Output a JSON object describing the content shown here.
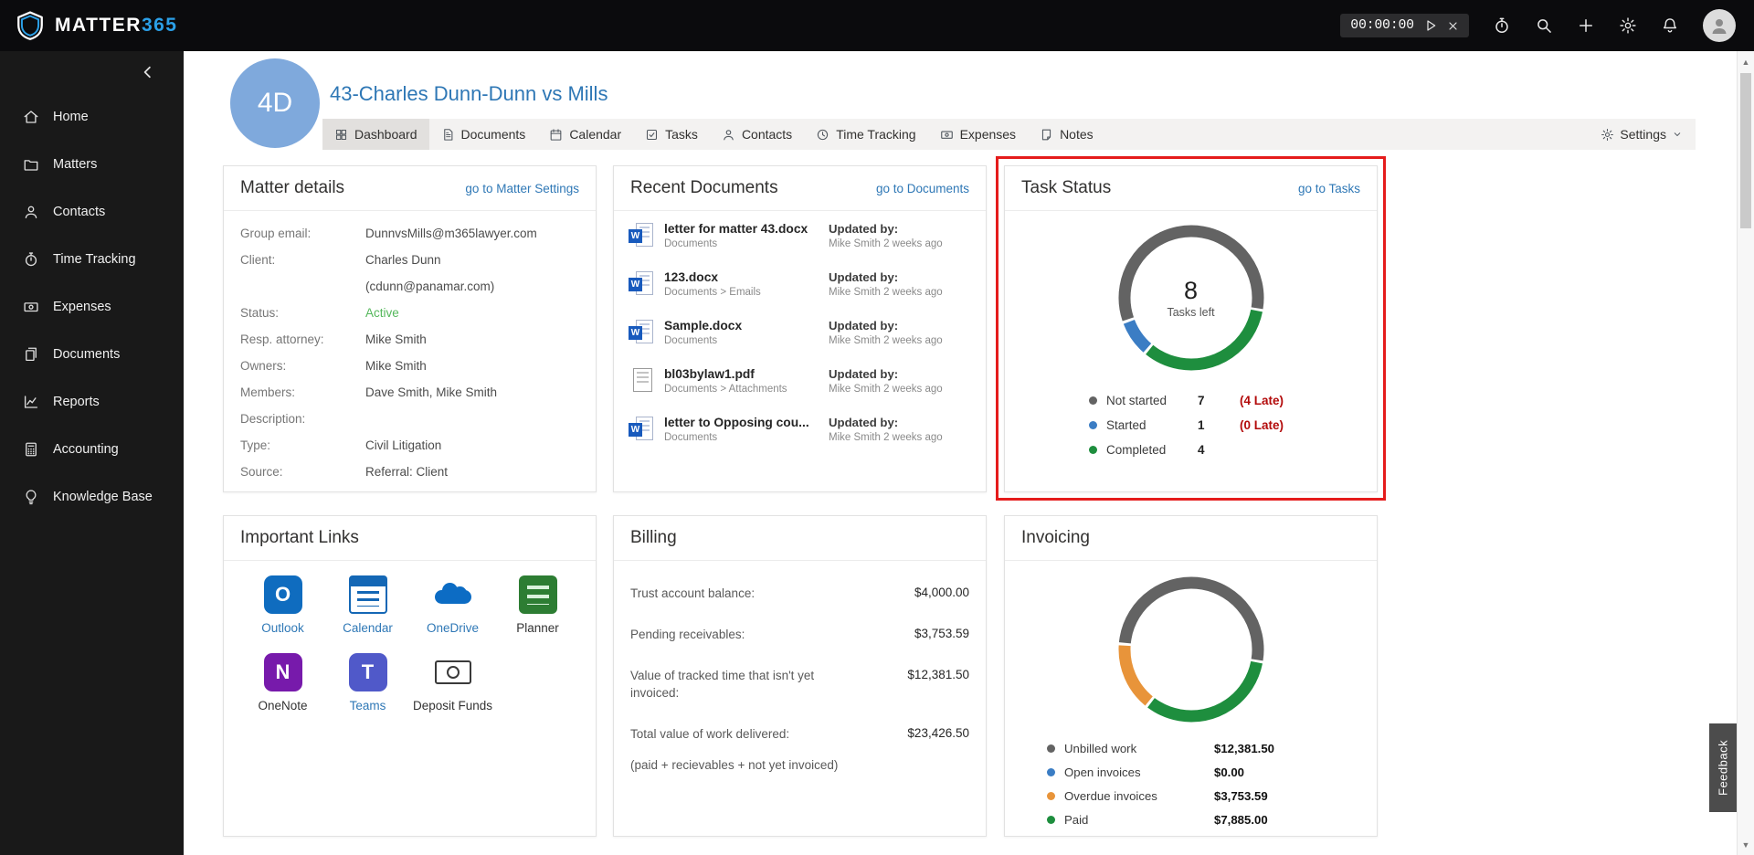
{
  "topbar": {
    "brand_primary": "MATTER",
    "brand_secondary": "365",
    "timer_value": "00:00:00"
  },
  "sidebar": {
    "items": [
      {
        "label": "Home",
        "icon": "#i-home"
      },
      {
        "label": "Matters",
        "icon": "#i-folder"
      },
      {
        "label": "Contacts",
        "icon": "#i-person"
      },
      {
        "label": "Time Tracking",
        "icon": "#i-stopwatch"
      },
      {
        "label": "Expenses",
        "icon": "#i-money"
      },
      {
        "label": "Documents",
        "icon": "#i-docs"
      },
      {
        "label": "Reports",
        "icon": "#i-chart"
      },
      {
        "label": "Accounting",
        "icon": "#i-calc"
      },
      {
        "label": "Knowledge Base",
        "icon": "#i-bulb"
      }
    ]
  },
  "matter": {
    "avatar_initials": "4D",
    "title": "43-Charles Dunn-Dunn vs Mills"
  },
  "tabs": [
    {
      "label": "Dashboard",
      "icon": "#i-grid",
      "active": "active"
    },
    {
      "label": "Documents",
      "icon": "#i-doc"
    },
    {
      "label": "Calendar",
      "icon": "#i-calendar"
    },
    {
      "label": "Tasks",
      "icon": "#i-tasks"
    },
    {
      "label": "Contacts",
      "icon": "#i-person"
    },
    {
      "label": "Time Tracking",
      "icon": "#i-clock"
    },
    {
      "label": "Expenses",
      "icon": "#i-money"
    },
    {
      "label": "Notes",
      "icon": "#i-note"
    }
  ],
  "settings_label": "Settings",
  "matter_details": {
    "title": "Matter details",
    "link": "go to Matter Settings",
    "rows": [
      {
        "label": "Group email:",
        "value": "DunnvsMills@m365lawyer.com"
      },
      {
        "label": "Client:",
        "value": "Charles Dunn"
      },
      {
        "label": "",
        "value": "(cdunn@panamar.com)"
      },
      {
        "label": "Status:",
        "value": "Active",
        "value_class": "green"
      },
      {
        "label": "Resp. attorney:",
        "value": "Mike Smith"
      },
      {
        "label": "Owners:",
        "value": "Mike Smith"
      },
      {
        "label": "Members:",
        "value": "Dave Smith, Mike Smith"
      },
      {
        "label": "Description:",
        "value": ""
      },
      {
        "label": "Type:",
        "value": "Civil Litigation"
      },
      {
        "label": "Source:",
        "value": "Referral: Client"
      }
    ]
  },
  "recent_documents": {
    "title": "Recent Documents",
    "link": "go to Documents",
    "items": [
      {
        "name": "letter for matter 43.docx",
        "path": "Documents",
        "doctype": "word",
        "updated_label": "Updated by:",
        "updated_meta": "Mike Smith 2 weeks ago"
      },
      {
        "name": "123.docx",
        "path": "Documents > Emails",
        "doctype": "word",
        "updated_label": "Updated by:",
        "updated_meta": "Mike Smith 2 weeks ago"
      },
      {
        "name": "Sample.docx",
        "path": "Documents",
        "doctype": "word",
        "updated_label": "Updated by:",
        "updated_meta": "Mike Smith 2 weeks ago"
      },
      {
        "name": "bl03bylaw1.pdf",
        "path": "Documents > Attachments",
        "doctype": "pdf",
        "updated_label": "Updated by:",
        "updated_meta": "Mike Smith 2 weeks ago"
      },
      {
        "name": "letter to Opposing cou...",
        "path": "Documents",
        "doctype": "word",
        "updated_label": "Updated by:",
        "updated_meta": "Mike Smith 2 weeks ago"
      }
    ]
  },
  "task_status": {
    "title": "Task Status",
    "link": "go to Tasks",
    "center_value": "8",
    "center_label": "Tasks left",
    "legend": [
      {
        "name": "Not started",
        "count": "7",
        "late": "(4 Late)",
        "color": "#636363"
      },
      {
        "name": "Started",
        "count": "1",
        "late": "(0 Late)",
        "color": "#3b7dc4"
      },
      {
        "name": "Completed",
        "count": "4",
        "late": "",
        "color": "#1e8e3e"
      }
    ]
  },
  "important_links": {
    "title": "Important Links",
    "items": [
      {
        "label": "Outlook",
        "icon": "outlook",
        "style": "blue"
      },
      {
        "label": "Calendar",
        "icon": "calendar",
        "style": "blue"
      },
      {
        "label": "OneDrive",
        "icon": "onedrive",
        "style": "blue"
      },
      {
        "label": "Planner",
        "icon": "planner",
        "style": "dark"
      },
      {
        "label": "OneNote",
        "icon": "onenote",
        "style": "dark"
      },
      {
        "label": "Teams",
        "icon": "teams",
        "style": "blue"
      },
      {
        "label": "Deposit Funds",
        "icon": "deposit",
        "style": "dark"
      }
    ]
  },
  "billing": {
    "title": "Billing",
    "rows": [
      {
        "label": "Trust account balance:",
        "value": "$4,000.00"
      },
      {
        "label": "Pending receivables:",
        "value": "$3,753.59"
      },
      {
        "label": "Value of tracked time that isn't yet invoiced:",
        "value": "$12,381.50"
      },
      {
        "label": "Total value of work delivered:",
        "value": "$23,426.50"
      },
      {
        "label": "(paid + recievables + not yet invoiced)",
        "value": ""
      }
    ]
  },
  "invoicing": {
    "title": "Invoicing",
    "legend": [
      {
        "name": "Unbilled work",
        "amount": "$12,381.50",
        "color": "#636363"
      },
      {
        "name": "Open invoices",
        "amount": "$0.00",
        "color": "#3b7dc4"
      },
      {
        "name": "Overdue invoices",
        "amount": "$3,753.59",
        "color": "#e8943a"
      },
      {
        "name": "Paid",
        "amount": "$7,885.00",
        "color": "#1e8e3e"
      }
    ]
  },
  "chart_data": [
    {
      "type": "donut",
      "title": "Task Status",
      "center_value": 8,
      "center_label": "Tasks left",
      "legend_position": "bottom",
      "segments": [
        {
          "name": "Not started",
          "value": 7,
          "late": 4,
          "color": "#636363"
        },
        {
          "name": "Started",
          "value": 1,
          "late": 0,
          "color": "#3b7dc4"
        },
        {
          "name": "Completed",
          "value": 4,
          "color": "#1e8e3e"
        }
      ]
    },
    {
      "type": "donut",
      "title": "Invoicing",
      "legend_position": "bottom",
      "segments": [
        {
          "name": "Unbilled work",
          "value": 12381.5,
          "color": "#636363"
        },
        {
          "name": "Open invoices",
          "value": 0,
          "color": "#3b7dc4"
        },
        {
          "name": "Overdue invoices",
          "value": 3753.59,
          "color": "#e8943a"
        },
        {
          "name": "Paid",
          "value": 7885.0,
          "color": "#1e8e3e"
        }
      ]
    }
  ],
  "feedback_label": "Feedback",
  "colors": {
    "accent_blue": "#2f78b6",
    "late_red": "#b30b0b",
    "status_green": "#55b85c",
    "highlight_red": "#e51c1c"
  }
}
